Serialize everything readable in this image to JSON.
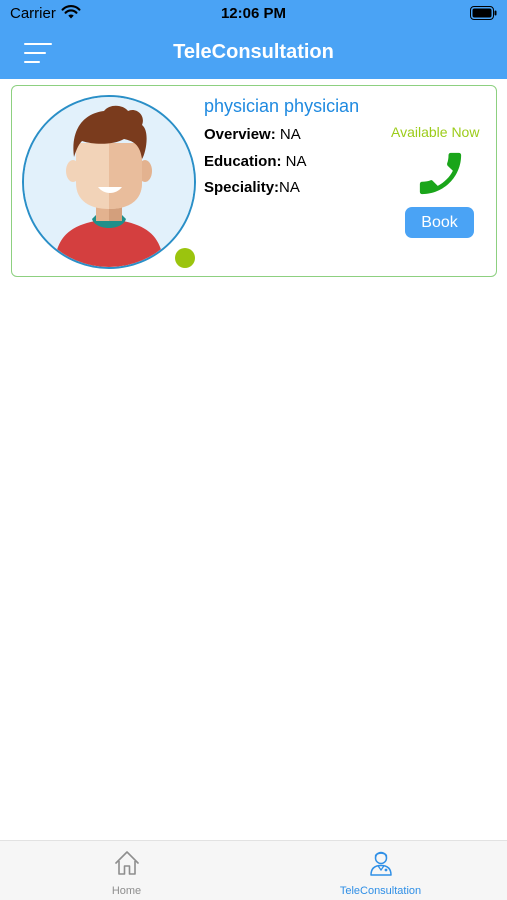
{
  "status_bar": {
    "carrier": "Carrier",
    "time": "12:06 PM"
  },
  "nav": {
    "title": "TeleConsultation",
    "menu_icon": "hamburger-icon"
  },
  "doctor": {
    "name": "physician physician",
    "overview_label": "Overview:",
    "overview_value": " NA",
    "education_label": "Education:",
    "education_value": " NA",
    "speciality_label": "Speciality:",
    "speciality_value": "NA",
    "availability": "Available Now",
    "book_label": "Book",
    "online": true
  },
  "tabs": [
    {
      "label": "Home",
      "icon": "home-icon",
      "active": false
    },
    {
      "label": "TeleConsultation",
      "icon": "doctor-icon",
      "active": true
    }
  ],
  "colors": {
    "primary": "#4aa3f5",
    "name": "#1f8ae0",
    "available": "#9ccc1a",
    "call": "#1aa51a",
    "online_dot": "#9bc40e",
    "card_border": "#8dd080"
  }
}
